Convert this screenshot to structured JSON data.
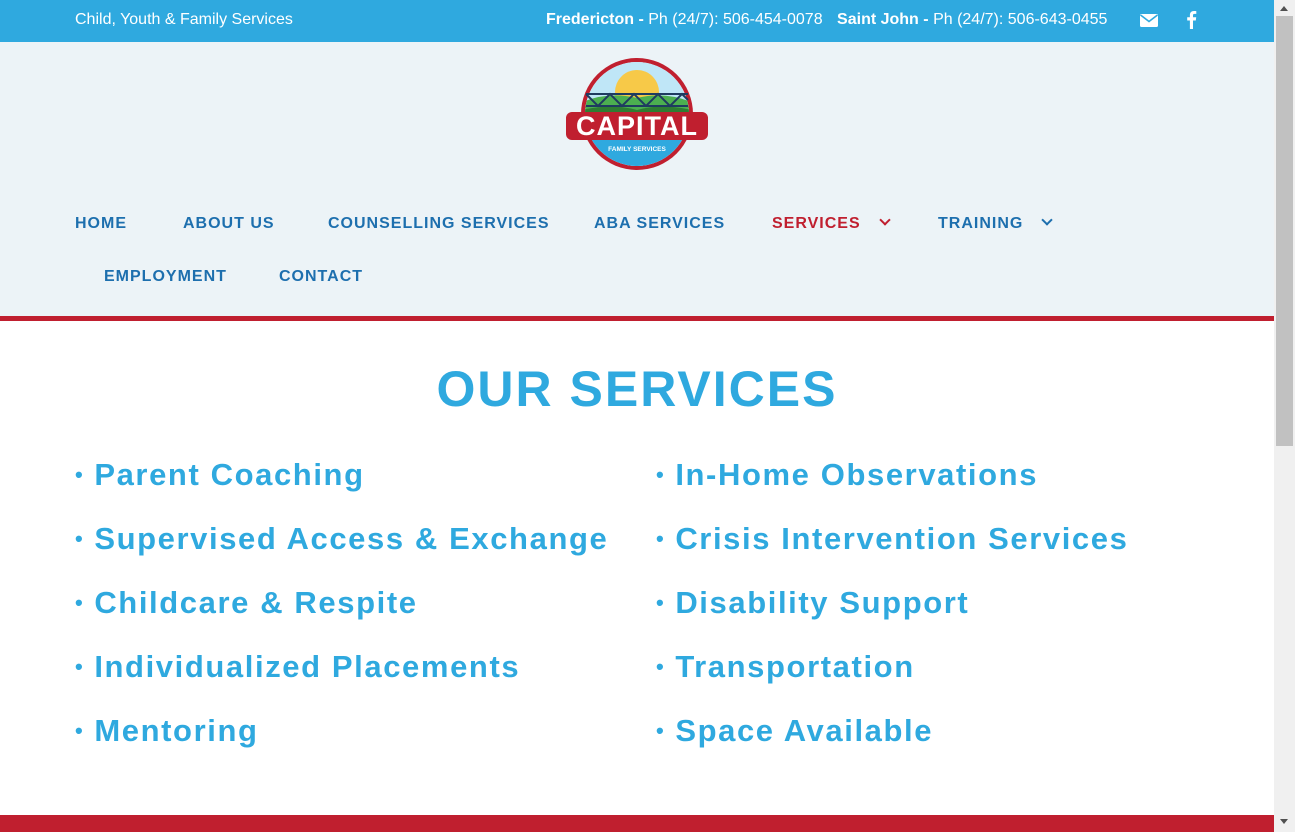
{
  "topbar": {
    "tagline": "Child, Youth & Family Services",
    "fredericton_label": "Fredericton -",
    "fredericton_phone": "Ph (24/7): 506-454-0078",
    "saintjohn_label": "Saint John -",
    "saintjohn_phone": "Ph (24/7): 506-643-0455"
  },
  "logo": {
    "name": "CAPITAL",
    "sub": "FAMILY SERVICES"
  },
  "nav": {
    "home": "HOME",
    "about": "ABOUT US",
    "counselling": "COUNSELLING SERVICES",
    "aba": "ABA SERVICES",
    "services": "SERVICES",
    "training": "TRAINING",
    "employment": "EMPLOYMENT",
    "contact": "CONTACT"
  },
  "main": {
    "title": "OUR SERVICES",
    "left": [
      "Parent Coaching",
      "Supervised Access & Exchange",
      "Childcare & Respite",
      "Individualized Placements",
      "Mentoring"
    ],
    "right": [
      "In-Home Observations",
      "Crisis Intervention Services",
      "Disability Support",
      "Transportation",
      "Space Available"
    ]
  },
  "colors": {
    "accent_blue": "#2fa9df",
    "nav_blue": "#1d6fae",
    "brand_red": "#c01f2f",
    "header_bg": "#ecf3f7"
  },
  "icons": {
    "email": "envelope-icon",
    "facebook": "facebook-icon",
    "dropdown": "chevron-down-icon"
  }
}
